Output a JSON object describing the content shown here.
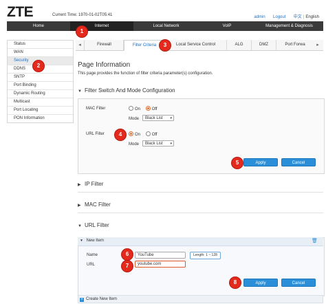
{
  "header": {
    "logo": "ZTE",
    "current_time_label": "Current Time:",
    "current_time": "1970-01-02T05:41",
    "user": "admin",
    "logout": "Logout",
    "lang_cn": "中文",
    "lang_sep": "|",
    "lang_en": "English"
  },
  "topnav": [
    "Home",
    "Internet",
    "Local Network",
    "VoIP",
    "Management & Diagnosis"
  ],
  "sidebar": [
    "Status",
    "WAN",
    "Security",
    "DDNS",
    "SNTP",
    "Port Binding",
    "Dynamic Routing",
    "Multicast",
    "Port Locating",
    "PON Information"
  ],
  "tabs": [
    "Firewall",
    "Filter Criteria",
    "Local Service Control",
    "ALG",
    "DMZ",
    "Port Forwa"
  ],
  "tab_arrow_left": "◂",
  "tab_arrow_right": "▸",
  "page": {
    "title": "Page Information",
    "desc": "This page provides the function of filter criteria parameter(s) configuration."
  },
  "switch_section": {
    "title": "Filter Switch And Mode Configuration",
    "mac_label": "MAC Filter",
    "url_label": "URL Filter",
    "on": "On",
    "off": "Off",
    "mode_label": "Mode",
    "mac_mode": "Black List",
    "url_mode": "Black List",
    "apply": "Apply",
    "cancel": "Cancel"
  },
  "ip_filter": "IP Filter",
  "mac_filter": "MAC Filter",
  "url_filter": {
    "title": "URL Filter",
    "new_item": "New Item",
    "name_label": "Name",
    "name_value": "YouTube",
    "url_label": "URL",
    "url_value": "youtube.com",
    "length_tip": "Length: 1 ~ 128",
    "apply": "Apply",
    "cancel": "Cancel",
    "create_new": "Create New Item"
  },
  "markers": [
    "1",
    "2",
    "3",
    "4",
    "5",
    "6",
    "7",
    "8"
  ],
  "icons": {
    "tri_down": "▼",
    "tri_right": "▶",
    "caret": "▾",
    "trash": "🗑",
    "plus": "+"
  },
  "colors": {
    "accent": "#1a6fc9",
    "button": "#2a8fd8",
    "marker": "#e42a1c",
    "radio_on": "#e06a2c"
  }
}
